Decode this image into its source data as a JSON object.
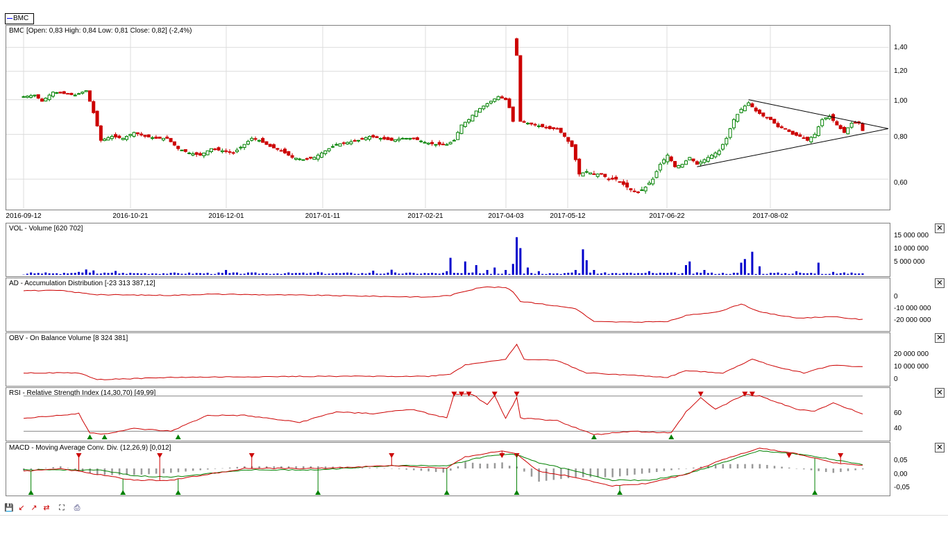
{
  "legend": {
    "symbol": "BMC"
  },
  "panels": {
    "price": {
      "title": "BMC [Open: 0,83  High: 0,84  Low: 0,81  Close: 0,82] (-2,4%)",
      "yticks": [
        "1,40",
        "1,20",
        "1,00",
        "0,80",
        "0,60"
      ]
    },
    "vol": {
      "title": "VOL - Volume [620 702]",
      "yticks": [
        "15 000 000",
        "10 000 000",
        "5 000 000"
      ]
    },
    "ad": {
      "title": "AD - Accumulation Distribution [-23 313 387,12]",
      "yticks": [
        "0",
        "-10 000 000",
        "-20 000 000"
      ]
    },
    "obv": {
      "title": "OBV - On Balance Volume [8 324 381]",
      "yticks": [
        "20 000 000",
        "10 000 000",
        "0"
      ]
    },
    "rsi": {
      "title": "RSI - Relative Strength Index (14,30,70) [49,99]",
      "yticks": [
        "60",
        "40"
      ]
    },
    "macd": {
      "title": "MACD - Moving Average Conv. Div. (12,26,9) [0,012]",
      "yticks": [
        "0,05",
        "0,00",
        "-0,05"
      ]
    }
  },
  "xaxis": [
    "2016-09-12",
    "2016-10-21",
    "2016-12-01",
    "2017-01-11",
    "2017-02-21",
    "2017-04-03",
    "2017-05-12",
    "2017-06-22",
    "2017-08-02"
  ],
  "close_glyph": "✕",
  "toolbar": [
    "save-icon",
    "zoom-out-icon",
    "zoom-in-icon",
    "zoom-reset-icon",
    "fit-icon",
    "print-icon"
  ],
  "colors": {
    "up": "#008000",
    "down": "#cc0000",
    "volume": "#0000cc",
    "line": "#cc0000",
    "signal": "#008000",
    "hist": "#999999"
  },
  "chart_data": [
    {
      "type": "candlestick",
      "title": "BMC [Open: 0,83  High: 0,84  Low: 0,81  Close: 0,82] (-2,4%)",
      "ylim": [
        0.5,
        1.56
      ],
      "x": [
        "2016-09-12",
        "2016-10-21",
        "2016-12-01",
        "2017-01-11",
        "2017-02-21",
        "2017-04-03",
        "2017-05-12",
        "2017-06-22",
        "2017-08-02"
      ],
      "close_path": [
        [
          0,
          1.02
        ],
        [
          3,
          1.03
        ],
        [
          5,
          0.99
        ],
        [
          8,
          1.05
        ],
        [
          11,
          1.04
        ],
        [
          14,
          1.03
        ],
        [
          17,
          1.06
        ],
        [
          19,
          0.92
        ],
        [
          21,
          0.77
        ],
        [
          24,
          0.79
        ],
        [
          27,
          0.78
        ],
        [
          30,
          0.81
        ],
        [
          33,
          0.79
        ],
        [
          36,
          0.78
        ],
        [
          39,
          0.78
        ],
        [
          42,
          0.73
        ],
        [
          45,
          0.71
        ],
        [
          48,
          0.7
        ],
        [
          51,
          0.73
        ],
        [
          54,
          0.72
        ],
        [
          57,
          0.71
        ],
        [
          60,
          0.75
        ],
        [
          62,
          0.78
        ],
        [
          64,
          0.77
        ],
        [
          67,
          0.74
        ],
        [
          70,
          0.72
        ],
        [
          73,
          0.69
        ],
        [
          76,
          0.68
        ],
        [
          79,
          0.69
        ],
        [
          82,
          0.72
        ],
        [
          85,
          0.75
        ],
        [
          88,
          0.76
        ],
        [
          91,
          0.77
        ],
        [
          94,
          0.79
        ],
        [
          97,
          0.78
        ],
        [
          100,
          0.77
        ],
        [
          103,
          0.78
        ],
        [
          106,
          0.78
        ],
        [
          109,
          0.76
        ],
        [
          112,
          0.75
        ],
        [
          115,
          0.75
        ],
        [
          117,
          0.77
        ],
        [
          119,
          0.85
        ],
        [
          121,
          0.88
        ],
        [
          123,
          0.93
        ],
        [
          125,
          0.96
        ],
        [
          127,
          0.99
        ],
        [
          129,
          1.02
        ],
        [
          131,
          1.0
        ],
        [
          132,
          0.95
        ],
        [
          133,
          0.87
        ],
        [
          134,
          1.33
        ],
        [
          135,
          0.87
        ],
        [
          137,
          0.86
        ],
        [
          139,
          0.85
        ],
        [
          141,
          0.84
        ],
        [
          143,
          0.83
        ],
        [
          145,
          0.83
        ],
        [
          147,
          0.79
        ],
        [
          149,
          0.74
        ],
        [
          151,
          0.62
        ],
        [
          153,
          0.63
        ],
        [
          155,
          0.62
        ],
        [
          157,
          0.62
        ],
        [
          159,
          0.6
        ],
        [
          161,
          0.6
        ],
        [
          163,
          0.58
        ],
        [
          165,
          0.56
        ],
        [
          167,
          0.55
        ],
        [
          169,
          0.57
        ],
        [
          171,
          0.6
        ],
        [
          173,
          0.66
        ],
        [
          175,
          0.7
        ],
        [
          177,
          0.65
        ],
        [
          179,
          0.66
        ],
        [
          181,
          0.69
        ],
        [
          183,
          0.66
        ],
        [
          185,
          0.68
        ],
        [
          187,
          0.7
        ],
        [
          189,
          0.72
        ],
        [
          191,
          0.78
        ],
        [
          193,
          0.88
        ],
        [
          195,
          0.94
        ],
        [
          197,
          0.98
        ],
        [
          199,
          0.93
        ],
        [
          201,
          0.9
        ],
        [
          203,
          0.88
        ],
        [
          205,
          0.84
        ],
        [
          207,
          0.83
        ],
        [
          209,
          0.8
        ],
        [
          211,
          0.79
        ],
        [
          213,
          0.77
        ],
        [
          215,
          0.8
        ],
        [
          217,
          0.88
        ],
        [
          219,
          0.9
        ],
        [
          221,
          0.85
        ],
        [
          223,
          0.81
        ],
        [
          225,
          0.86
        ],
        [
          227,
          0.86
        ],
        [
          228,
          0.82
        ]
      ],
      "triangle": {
        "upper": [
          [
            197,
            1.0
          ],
          [
            229,
            0.83
          ]
        ],
        "lower": [
          [
            183,
            0.65
          ],
          [
            229,
            0.83
          ]
        ]
      }
    },
    {
      "type": "bar",
      "title": "VOL - Volume [620 702]",
      "series": [
        {
          "name": "VOL",
          "values_by_index": [
            [
              0,
              0.1
            ],
            [
              10,
              0.3
            ],
            [
              15,
              1.2
            ],
            [
              17,
              2.2
            ],
            [
              19,
              1.8
            ],
            [
              25,
              1.6
            ],
            [
              40,
              0.8
            ],
            [
              55,
              2.0
            ],
            [
              80,
              1.2
            ],
            [
              95,
              1.7
            ],
            [
              100,
              2.1
            ],
            [
              115,
              1.5
            ],
            [
              116,
              7.0
            ],
            [
              120,
              5.5
            ],
            [
              123,
              4.0
            ],
            [
              126,
              2.0
            ],
            [
              128,
              3.0
            ],
            [
              131,
              2.0
            ],
            [
              133,
              4.5
            ],
            [
              134,
              15.5
            ],
            [
              135,
              11.0
            ],
            [
              137,
              3.0
            ],
            [
              140,
              1.5
            ],
            [
              150,
              2.0
            ],
            [
              152,
              10.5
            ],
            [
              153,
              6.0
            ],
            [
              155,
              2.0
            ],
            [
              170,
              1.5
            ],
            [
              180,
              4.0
            ],
            [
              181,
              5.5
            ],
            [
              185,
              2.0
            ],
            [
              195,
              5.0
            ],
            [
              196,
              6.5
            ],
            [
              198,
              9.5
            ],
            [
              200,
              3.5
            ],
            [
              210,
              1.5
            ],
            [
              216,
              5.0
            ],
            [
              220,
              1.2
            ],
            [
              228,
              0.6
            ]
          ]
        }
      ]
    },
    {
      "type": "line",
      "title": "AD - Accumulation Distribution [-23 313 387,12]",
      "series": [
        {
          "name": "AD",
          "points": [
            [
              0,
              1.0
            ],
            [
              10,
              1.0
            ],
            [
              20,
              -2.5
            ],
            [
              40,
              -3.0
            ],
            [
              50,
              -2.0
            ],
            [
              80,
              -3.0
            ],
            [
              110,
              -4.5
            ],
            [
              116,
              -3.0
            ],
            [
              120,
              0.5
            ],
            [
              125,
              4.0
            ],
            [
              131,
              3.5
            ],
            [
              133,
              0.0
            ],
            [
              135,
              -8.0
            ],
            [
              140,
              -10.0
            ],
            [
              150,
              -14.0
            ],
            [
              155,
              -25.0
            ],
            [
              165,
              -25.5
            ],
            [
              175,
              -25.0
            ],
            [
              180,
              -20.0
            ],
            [
              190,
              -16.0
            ],
            [
              195,
              -10.0
            ],
            [
              200,
              -17.0
            ],
            [
              210,
              -22.0
            ],
            [
              220,
              -21.0
            ],
            [
              228,
              -23.3
            ]
          ]
        }
      ]
    },
    {
      "type": "line",
      "title": "OBV - On Balance Volume [8 324 381]",
      "series": [
        {
          "name": "OBV",
          "points": [
            [
              0,
              3.0
            ],
            [
              15,
              3.0
            ],
            [
              20,
              -3.0
            ],
            [
              40,
              -1.0
            ],
            [
              80,
              0.0
            ],
            [
              110,
              0.0
            ],
            [
              116,
              2.0
            ],
            [
              120,
              10.0
            ],
            [
              126,
              13.0
            ],
            [
              131,
              15.0
            ],
            [
              134,
              28.0
            ],
            [
              136,
              15.0
            ],
            [
              145,
              14.0
            ],
            [
              153,
              3.0
            ],
            [
              165,
              1.0
            ],
            [
              175,
              -1.0
            ],
            [
              180,
              5.0
            ],
            [
              190,
              3.0
            ],
            [
              198,
              15.0
            ],
            [
              205,
              8.0
            ],
            [
              212,
              3.0
            ],
            [
              220,
              10.0
            ],
            [
              228,
              8.3
            ]
          ]
        }
      ]
    },
    {
      "type": "line",
      "title": "RSI - Relative Strength Index (14,30,70) [49,99]",
      "ylim": [
        20,
        80
      ],
      "guides": [
        30,
        70
      ],
      "series": [
        {
          "name": "RSI",
          "points": [
            [
              0,
              45
            ],
            [
              10,
              48
            ],
            [
              15,
              50
            ],
            [
              18,
              28
            ],
            [
              22,
              27
            ],
            [
              30,
              33
            ],
            [
              40,
              30
            ],
            [
              50,
              48
            ],
            [
              60,
              48
            ],
            [
              75,
              40
            ],
            [
              85,
              52
            ],
            [
              95,
              50
            ],
            [
              105,
              55
            ],
            [
              115,
              45
            ],
            [
              117,
              72
            ],
            [
              122,
              72
            ],
            [
              126,
              60
            ],
            [
              128,
              70
            ],
            [
              131,
              45
            ],
            [
              134,
              68
            ],
            [
              135,
              45
            ],
            [
              145,
              42
            ],
            [
              155,
              26
            ],
            [
              165,
              30
            ],
            [
              176,
              28
            ],
            [
              180,
              52
            ],
            [
              184,
              68
            ],
            [
              188,
              55
            ],
            [
              196,
              72
            ],
            [
              200,
              70
            ],
            [
              210,
              55
            ],
            [
              215,
              53
            ],
            [
              220,
              62
            ],
            [
              228,
              50
            ]
          ]
        }
      ]
    },
    {
      "type": "line",
      "title": "MACD - Moving Average Conv. Div. (12,26,9) [0,012]",
      "ylim": [
        -0.09,
        0.09
      ],
      "series": [
        {
          "name": "MACD",
          "points": [
            [
              0,
              -0.01
            ],
            [
              10,
              0.0
            ],
            [
              20,
              -0.02
            ],
            [
              30,
              -0.04
            ],
            [
              40,
              -0.04
            ],
            [
              60,
              0.0
            ],
            [
              80,
              0.0
            ],
            [
              100,
              0.01
            ],
            [
              115,
              0.0
            ],
            [
              120,
              0.04
            ],
            [
              130,
              0.06
            ],
            [
              134,
              0.05
            ],
            [
              140,
              -0.01
            ],
            [
              150,
              -0.03
            ],
            [
              160,
              -0.06
            ],
            [
              170,
              -0.05
            ],
            [
              180,
              -0.02
            ],
            [
              190,
              0.03
            ],
            [
              200,
              0.07
            ],
            [
              210,
              0.05
            ],
            [
              220,
              0.02
            ],
            [
              228,
              0.01
            ]
          ]
        },
        {
          "name": "Signal",
          "points": [
            [
              0,
              -0.005
            ],
            [
              20,
              -0.005
            ],
            [
              30,
              -0.025
            ],
            [
              40,
              -0.03
            ],
            [
              60,
              -0.005
            ],
            [
              80,
              -0.005
            ],
            [
              100,
              0.01
            ],
            [
              115,
              0.01
            ],
            [
              125,
              0.04
            ],
            [
              133,
              0.05
            ],
            [
              140,
              0.02
            ],
            [
              150,
              -0.01
            ],
            [
              160,
              -0.04
            ],
            [
              170,
              -0.04
            ],
            [
              180,
              -0.02
            ],
            [
              190,
              0.02
            ],
            [
              200,
              0.06
            ],
            [
              210,
              0.05
            ],
            [
              220,
              0.03
            ],
            [
              228,
              0.012
            ]
          ]
        }
      ]
    }
  ]
}
